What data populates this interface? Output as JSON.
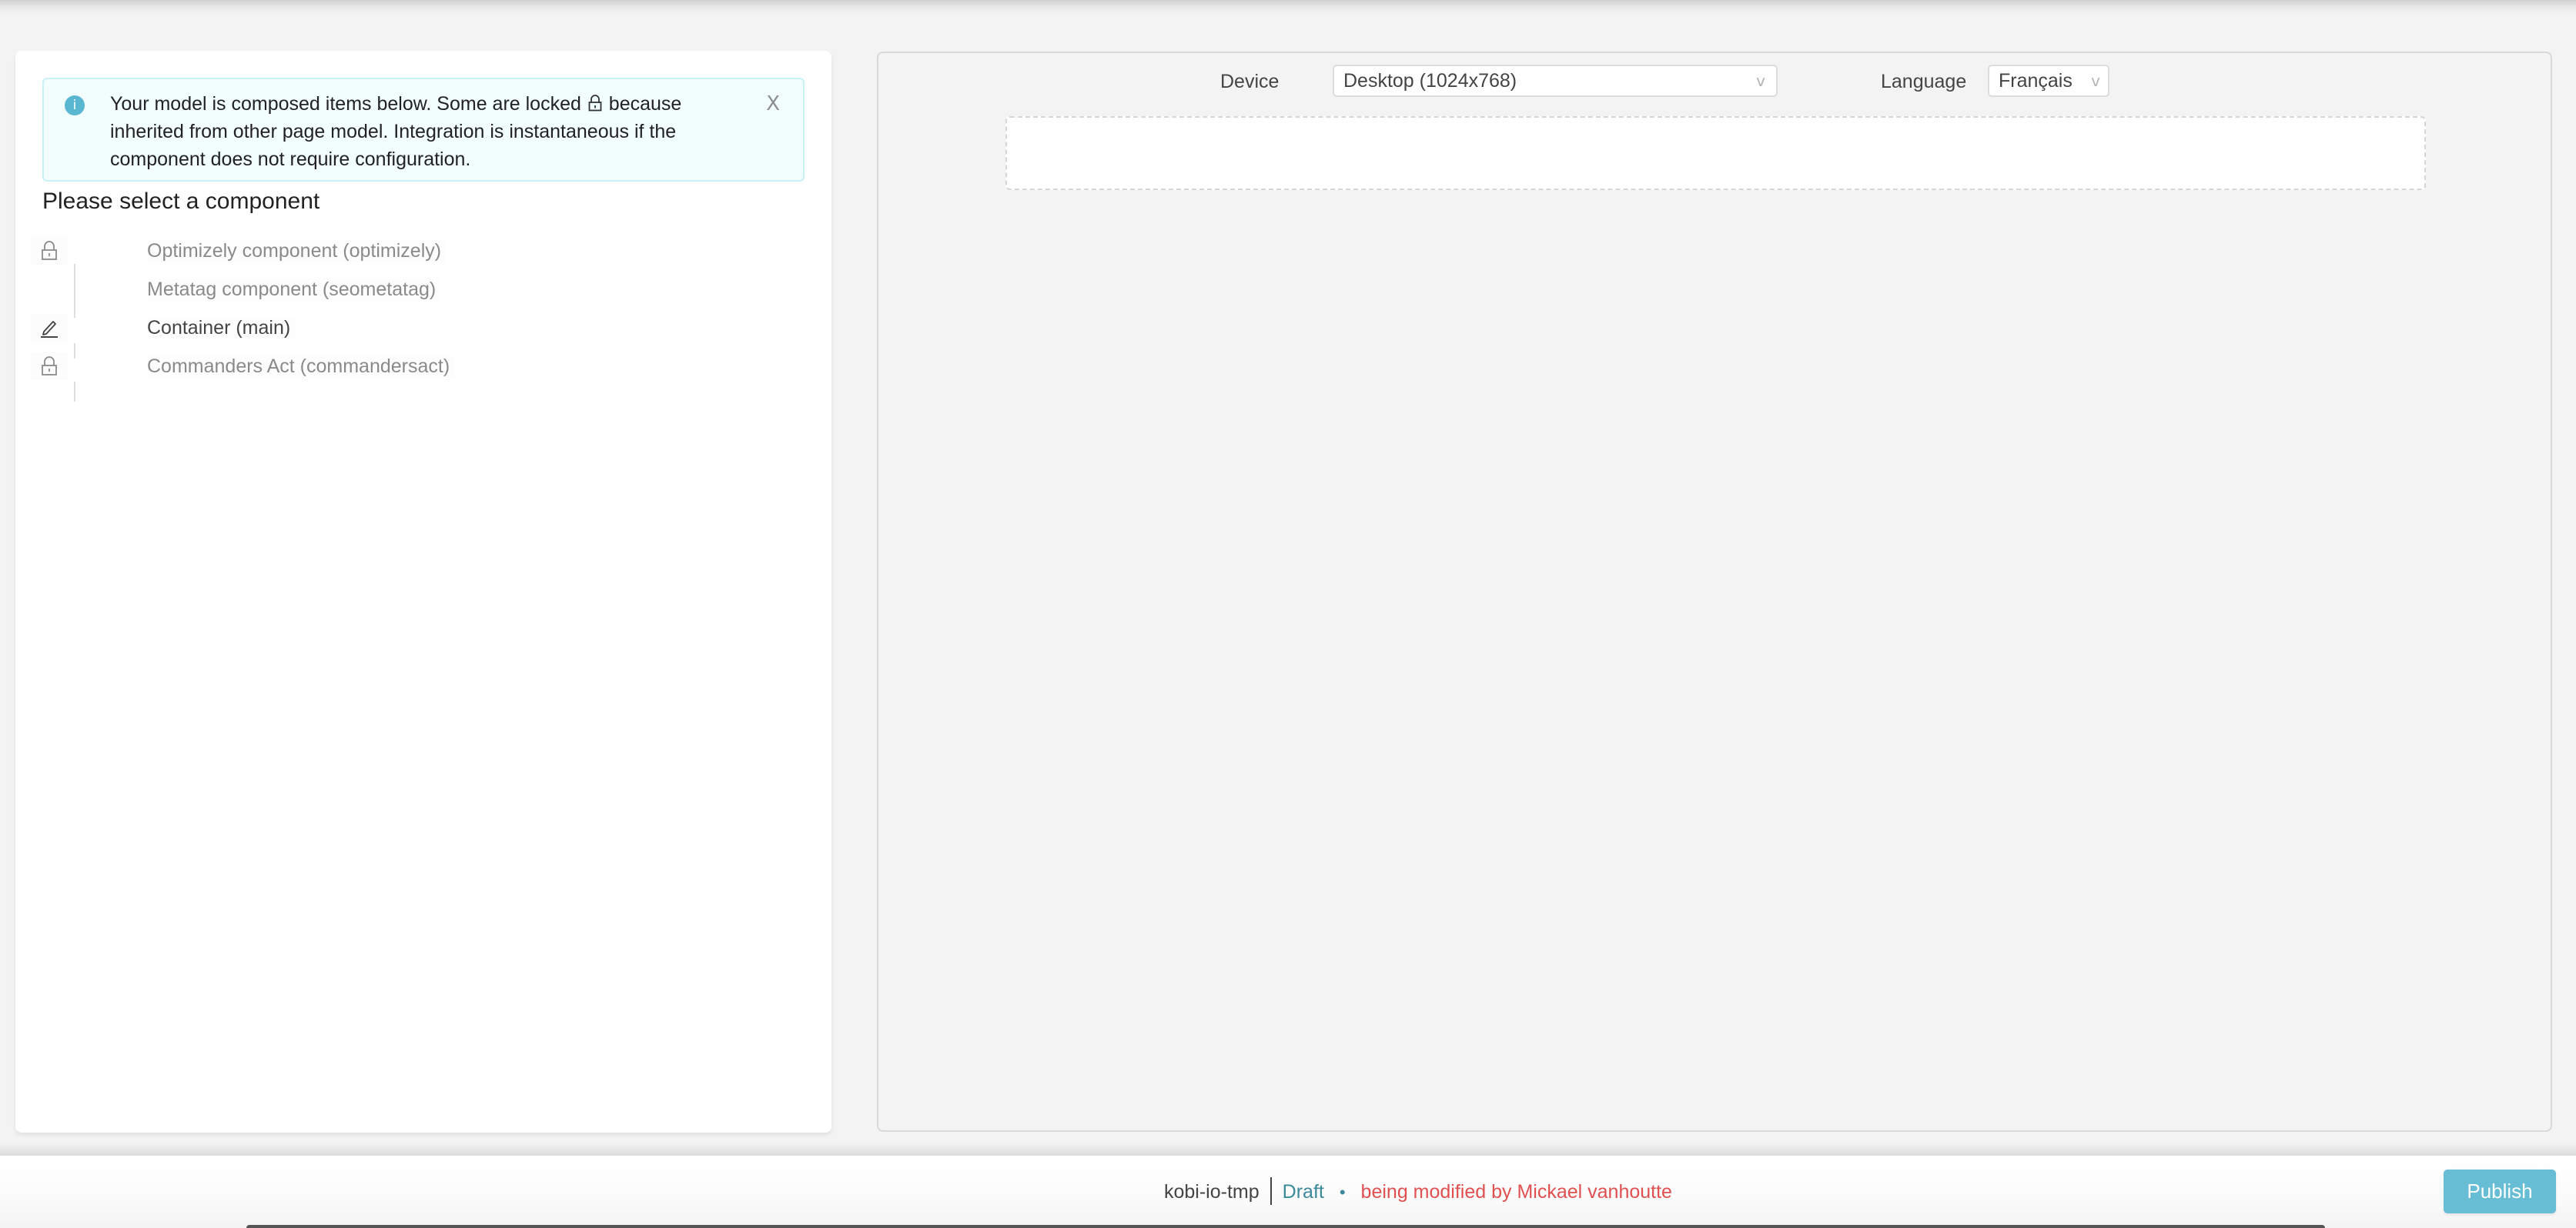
{
  "left_panel": {
    "info": {
      "icon": "info-icon",
      "text_before_lock": "Your model is composed items below. Some are locked",
      "text_after_lock": "because inherited from other page model. Integration is instantaneous if the component does not require configuration.",
      "close_label": "X"
    },
    "heading": "Please select a component",
    "components": [
      {
        "label": "Optimizely component (optimizely)",
        "icon": "lock-icon",
        "state": "locked"
      },
      {
        "label": "Metatag component (seometatag)",
        "icon": "",
        "state": "locked"
      },
      {
        "label": "Container (main)",
        "icon": "pencil-icon",
        "state": "editable"
      },
      {
        "label": "Commanders Act (commandersact)",
        "icon": "lock-icon",
        "state": "locked"
      }
    ]
  },
  "canvas": {
    "device_label": "Device",
    "device_value": "Desktop (1024x768)",
    "language_label": "Language",
    "language_value": "Français",
    "chevron": "v"
  },
  "footer": {
    "site_name": "kobi-io-tmp",
    "status": "Draft",
    "separator": "•",
    "modified_text": "being modified by Mickael vanhoutte",
    "publish_label": "Publish"
  },
  "colors": {
    "accent": "#66bdd4",
    "draft": "#3a8a9b",
    "warning": "#e05050",
    "info_bg": "#f2fdfe",
    "info_border": "#c9f1f7"
  }
}
